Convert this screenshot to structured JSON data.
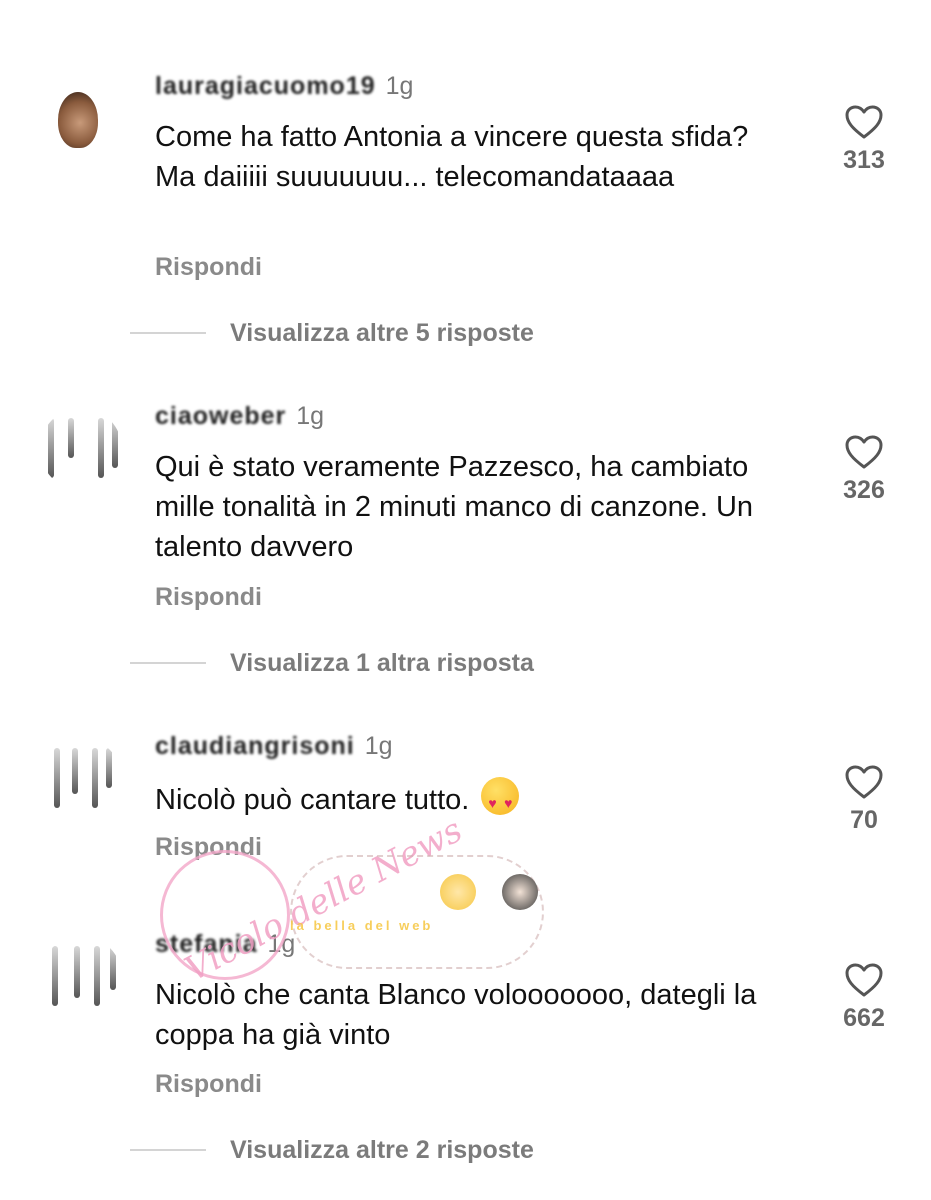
{
  "comments": [
    {
      "username": "lauragiacuomo19",
      "time": "1g",
      "text": "Come ha fatto Antonia a vincere questa sfida? Ma daiiiii suuuuuuu... telecomandataaaa",
      "reply_label": "Rispondi",
      "likes": "313",
      "view_replies": "Visualizza altre 5 risposte"
    },
    {
      "username": "ciaoweber",
      "time": "1g",
      "text": "Qui è stato veramente Pazzesco, ha cambiato mille tonalità in 2 minuti manco di canzone. Un talento davvero",
      "reply_label": "Rispondi",
      "likes": "326",
      "view_replies": "Visualizza 1 altra risposta"
    },
    {
      "username": "claudiangrisoni",
      "time": "1g",
      "text": "Nicolò può cantare tutto.",
      "emoji": "heart-eyes-emoji",
      "reply_label": "Rispondi",
      "likes": "70",
      "view_replies": ""
    },
    {
      "username": "stefania",
      "time": "1g",
      "text": "Nicolò che canta Blanco volooooooo, dategli la coppa ha già vinto",
      "reply_label": "Rispondi",
      "likes": "662",
      "view_replies": "Visualizza altre 2 risposte"
    }
  ],
  "watermark": {
    "script": "Vicolo delle News",
    "banner": "la bella del web"
  },
  "icons": {
    "like": "heart-outline-icon"
  },
  "colors": {
    "text": "#111111",
    "muted": "#7b7b7b",
    "divider": "#d4d4d4"
  }
}
